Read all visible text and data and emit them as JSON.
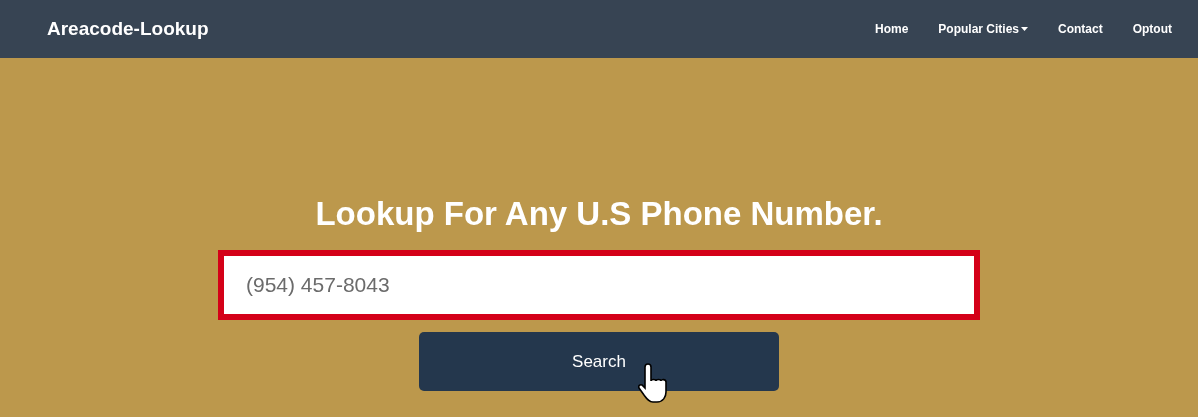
{
  "navbar": {
    "brand": "Areacode-Lookup",
    "items": [
      {
        "label": "Home",
        "kind": "link"
      },
      {
        "label": "Popular Cities",
        "kind": "dropdown"
      },
      {
        "label": "Contact",
        "kind": "link"
      },
      {
        "label": "Optout",
        "kind": "link"
      }
    ]
  },
  "hero": {
    "heading": "Lookup For Any U.S Phone Number.",
    "search": {
      "placeholder": "(954) 457-8043",
      "highlighted": true
    },
    "button": "Search"
  }
}
